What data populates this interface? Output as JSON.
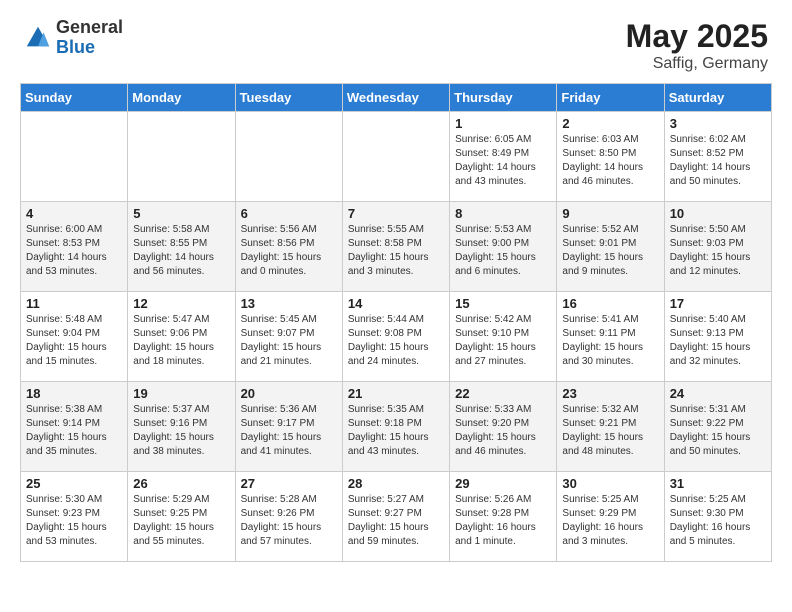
{
  "header": {
    "logo_general": "General",
    "logo_blue": "Blue",
    "title": "May 2025",
    "subtitle": "Saffig, Germany"
  },
  "days_of_week": [
    "Sunday",
    "Monday",
    "Tuesday",
    "Wednesday",
    "Thursday",
    "Friday",
    "Saturday"
  ],
  "weeks": [
    [
      {
        "day": "",
        "info": ""
      },
      {
        "day": "",
        "info": ""
      },
      {
        "day": "",
        "info": ""
      },
      {
        "day": "",
        "info": ""
      },
      {
        "day": "1",
        "info": "Sunrise: 6:05 AM\nSunset: 8:49 PM\nDaylight: 14 hours\nand 43 minutes."
      },
      {
        "day": "2",
        "info": "Sunrise: 6:03 AM\nSunset: 8:50 PM\nDaylight: 14 hours\nand 46 minutes."
      },
      {
        "day": "3",
        "info": "Sunrise: 6:02 AM\nSunset: 8:52 PM\nDaylight: 14 hours\nand 50 minutes."
      }
    ],
    [
      {
        "day": "4",
        "info": "Sunrise: 6:00 AM\nSunset: 8:53 PM\nDaylight: 14 hours\nand 53 minutes."
      },
      {
        "day": "5",
        "info": "Sunrise: 5:58 AM\nSunset: 8:55 PM\nDaylight: 14 hours\nand 56 minutes."
      },
      {
        "day": "6",
        "info": "Sunrise: 5:56 AM\nSunset: 8:56 PM\nDaylight: 15 hours\nand 0 minutes."
      },
      {
        "day": "7",
        "info": "Sunrise: 5:55 AM\nSunset: 8:58 PM\nDaylight: 15 hours\nand 3 minutes."
      },
      {
        "day": "8",
        "info": "Sunrise: 5:53 AM\nSunset: 9:00 PM\nDaylight: 15 hours\nand 6 minutes."
      },
      {
        "day": "9",
        "info": "Sunrise: 5:52 AM\nSunset: 9:01 PM\nDaylight: 15 hours\nand 9 minutes."
      },
      {
        "day": "10",
        "info": "Sunrise: 5:50 AM\nSunset: 9:03 PM\nDaylight: 15 hours\nand 12 minutes."
      }
    ],
    [
      {
        "day": "11",
        "info": "Sunrise: 5:48 AM\nSunset: 9:04 PM\nDaylight: 15 hours\nand 15 minutes."
      },
      {
        "day": "12",
        "info": "Sunrise: 5:47 AM\nSunset: 9:06 PM\nDaylight: 15 hours\nand 18 minutes."
      },
      {
        "day": "13",
        "info": "Sunrise: 5:45 AM\nSunset: 9:07 PM\nDaylight: 15 hours\nand 21 minutes."
      },
      {
        "day": "14",
        "info": "Sunrise: 5:44 AM\nSunset: 9:08 PM\nDaylight: 15 hours\nand 24 minutes."
      },
      {
        "day": "15",
        "info": "Sunrise: 5:42 AM\nSunset: 9:10 PM\nDaylight: 15 hours\nand 27 minutes."
      },
      {
        "day": "16",
        "info": "Sunrise: 5:41 AM\nSunset: 9:11 PM\nDaylight: 15 hours\nand 30 minutes."
      },
      {
        "day": "17",
        "info": "Sunrise: 5:40 AM\nSunset: 9:13 PM\nDaylight: 15 hours\nand 32 minutes."
      }
    ],
    [
      {
        "day": "18",
        "info": "Sunrise: 5:38 AM\nSunset: 9:14 PM\nDaylight: 15 hours\nand 35 minutes."
      },
      {
        "day": "19",
        "info": "Sunrise: 5:37 AM\nSunset: 9:16 PM\nDaylight: 15 hours\nand 38 minutes."
      },
      {
        "day": "20",
        "info": "Sunrise: 5:36 AM\nSunset: 9:17 PM\nDaylight: 15 hours\nand 41 minutes."
      },
      {
        "day": "21",
        "info": "Sunrise: 5:35 AM\nSunset: 9:18 PM\nDaylight: 15 hours\nand 43 minutes."
      },
      {
        "day": "22",
        "info": "Sunrise: 5:33 AM\nSunset: 9:20 PM\nDaylight: 15 hours\nand 46 minutes."
      },
      {
        "day": "23",
        "info": "Sunrise: 5:32 AM\nSunset: 9:21 PM\nDaylight: 15 hours\nand 48 minutes."
      },
      {
        "day": "24",
        "info": "Sunrise: 5:31 AM\nSunset: 9:22 PM\nDaylight: 15 hours\nand 50 minutes."
      }
    ],
    [
      {
        "day": "25",
        "info": "Sunrise: 5:30 AM\nSunset: 9:23 PM\nDaylight: 15 hours\nand 53 minutes."
      },
      {
        "day": "26",
        "info": "Sunrise: 5:29 AM\nSunset: 9:25 PM\nDaylight: 15 hours\nand 55 minutes."
      },
      {
        "day": "27",
        "info": "Sunrise: 5:28 AM\nSunset: 9:26 PM\nDaylight: 15 hours\nand 57 minutes."
      },
      {
        "day": "28",
        "info": "Sunrise: 5:27 AM\nSunset: 9:27 PM\nDaylight: 15 hours\nand 59 minutes."
      },
      {
        "day": "29",
        "info": "Sunrise: 5:26 AM\nSunset: 9:28 PM\nDaylight: 16 hours\nand 1 minute."
      },
      {
        "day": "30",
        "info": "Sunrise: 5:25 AM\nSunset: 9:29 PM\nDaylight: 16 hours\nand 3 minutes."
      },
      {
        "day": "31",
        "info": "Sunrise: 5:25 AM\nSunset: 9:30 PM\nDaylight: 16 hours\nand 5 minutes."
      }
    ]
  ]
}
